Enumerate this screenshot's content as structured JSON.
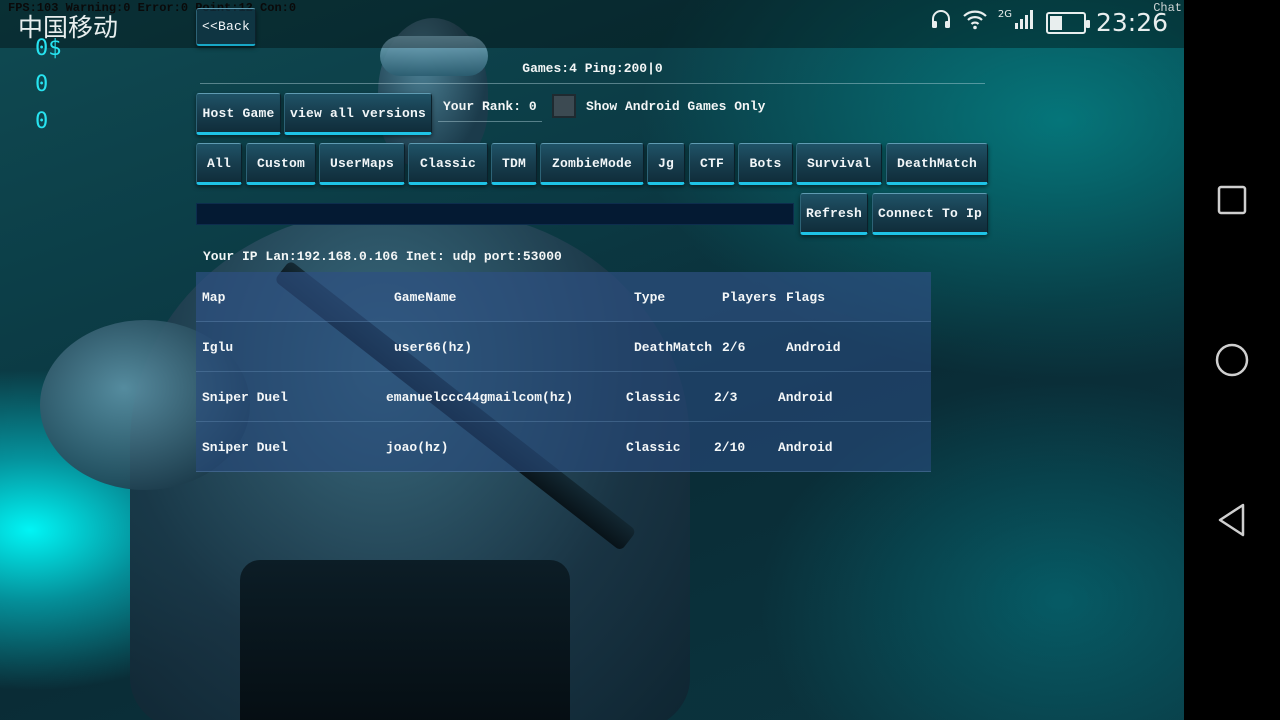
{
  "status_bar": {
    "carrier": "中国移动",
    "network_type": "2G",
    "clock": "23:26",
    "battery_level": 0.35,
    "icons": [
      "headphones-icon",
      "wifi-icon",
      "signal-icon",
      "battery-icon"
    ]
  },
  "debug": {
    "overlay": "FPS:103 Warning:0 Error:0 Point:12 Con:0",
    "chat_label": "Chat"
  },
  "counters": [
    "0$",
    "0",
    "0"
  ],
  "back_label": "<<Back",
  "summary": "Games:4 Ping:200|0",
  "host_game_label": "Host Game",
  "view_versions_label": "view all versions",
  "rank_label": "Your Rank: 0",
  "android_only_label": "Show Android Games Only",
  "filters": [
    "All",
    "Custom",
    "UserMaps",
    "Classic",
    "TDM",
    "ZombieMode",
    "Jg",
    "CTF",
    "Bots",
    "Survival",
    "DeathMatch"
  ],
  "ip_input": {
    "value": "",
    "placeholder": ""
  },
  "refresh_label": "Refresh",
  "connect_label": "Connect To Ip",
  "ip_info": "Your IP Lan:192.168.0.106 Inet: udp port:53000",
  "table": {
    "headers": [
      "Map",
      "GameName",
      "Type",
      "Players",
      "Flags"
    ],
    "rows": [
      [
        "Iglu",
        "user66(hz)",
        "DeathMatch",
        "2/6",
        "Android"
      ],
      [
        "Sniper Duel",
        "emanuelccc44gmailcom(hz)",
        "Classic",
        "2/3",
        "Android"
      ],
      [
        "Sniper Duel",
        "joao(hz)",
        "Classic",
        "2/10",
        "Android"
      ]
    ]
  },
  "colors": {
    "accent": "#1ec3e6",
    "counter": "#27e3f0",
    "table_row": "#284b7d"
  },
  "nav_icons": [
    "recents-square-icon",
    "home-circle-icon",
    "back-triangle-icon"
  ]
}
